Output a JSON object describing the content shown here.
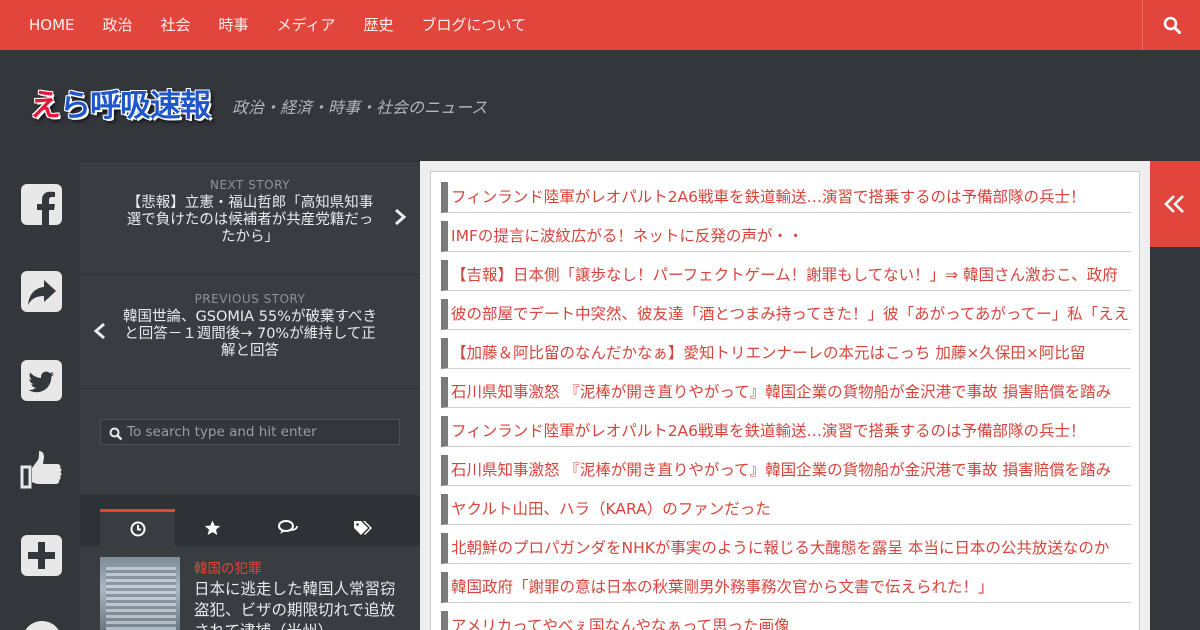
{
  "nav": {
    "items": [
      "HOME",
      "政治",
      "社会",
      "時事",
      "メディア",
      "歴史",
      "ブログについて"
    ],
    "search_icon": "search-icon"
  },
  "header": {
    "logo_red": "え",
    "logo_blue": "ら呼吸速報",
    "tagline": "政治・経済・時事・社会のニュース"
  },
  "share": {
    "icons": [
      "facebook-icon",
      "share-icon",
      "twitter-icon",
      "thumbs-up-icon",
      "plus-icon"
    ]
  },
  "sidebar": {
    "next": {
      "label": "NEXT STORY",
      "title": "【悲報】立憲・福山哲郎「高知県知事選で負けたのは候補者が共産党籍だったから」"
    },
    "prev": {
      "label": "PREVIOUS STORY",
      "title": "韓国世論、GSOMIA 55%が破棄すべきと回答－１週間後→ 70%が維持して正解と回答"
    },
    "search": {
      "placeholder": "To search type and hit enter"
    },
    "tabs": [
      "clock-icon",
      "star-icon",
      "comments-icon",
      "tags-icon"
    ],
    "post": {
      "category": "韓国の犯罪",
      "title": "日本に逃走した韓国人常習窃盗犯、ビザの期限切れで追放されて逮捕（光州）"
    }
  },
  "main": {
    "links": [
      "フィンランド陸軍がレオパルト2A6戦車を鉄道輸送…演習で搭乗するのは予備部隊の兵士！",
      "IMFの提言に波紋広がる！ネットに反発の声が・・",
      "【吉報】日本側「譲歩なし！パーフェクトゲーム！謝罪もしてない！」⇒ 韓国さん激おこ、政府",
      "彼の部屋でデート中突然、彼友達「酒とつまみ持ってきた！」彼「あがってあがってー」私「ええ",
      "【加藤＆阿比留のなんだかなぁ】愛知トリエンナーレの本元はこっち 加藤×久保田×阿比留",
      "石川県知事激怒 『泥棒が開き直りやがって』韓国企業の貨物船が金沢港で事故 損害賠償を踏み",
      "フィンランド陸軍がレオパルト2A6戦車を鉄道輸送…演習で搭乗するのは予備部隊の兵士！",
      "石川県知事激怒 『泥棒が開き直りやがって』韓国企業の貨物船が金沢港で事故 損害賠償を踏み",
      "ヤクルト山田、ハラ（KARA）のファンだった",
      "北朝鮮のプロパガンダをNHKが事実のように報じる大醜態を露呈 本当に日本の公共放送なのか",
      "韓国政府「謝罪の意は日本の秋葉剛男外務事務次官から文書で伝えられた！」",
      "アメリカってやべぇ国なんやなぁって思った画像"
    ]
  },
  "right": {
    "toggle_icon": "double-chevron-left-icon"
  },
  "colors": {
    "accent": "#e2453b",
    "dark": "#33363b",
    "link": "#d8443b"
  }
}
